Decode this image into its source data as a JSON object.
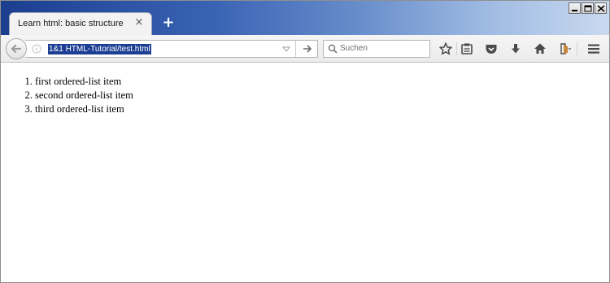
{
  "window": {
    "controls": [
      "minimize-icon",
      "maximize-icon",
      "close-icon"
    ]
  },
  "tab": {
    "title": "Learn html: basic structure",
    "close_glyph": "×",
    "new_tab_glyph": "+"
  },
  "navbar": {
    "url": "1&1 HTML-Tutorial/test.html",
    "search_placeholder": "Suchen",
    "icons": [
      "back-arrow-icon",
      "info-icon",
      "dropmarker-icon",
      "go-arrow-icon",
      "search-icon",
      "bookmark-star-icon",
      "reading-list-icon",
      "pocket-icon",
      "download-icon",
      "home-icon",
      "share-icon",
      "menu-icon"
    ]
  },
  "colors": {
    "tabstrip_start": "#1b3e8f",
    "tabstrip_end": "#c9d9ef",
    "url_selection": "#1c3f94"
  },
  "content": {
    "list_items": [
      "first ordered-list item",
      "second ordered-list item",
      "third ordered-list item"
    ]
  }
}
